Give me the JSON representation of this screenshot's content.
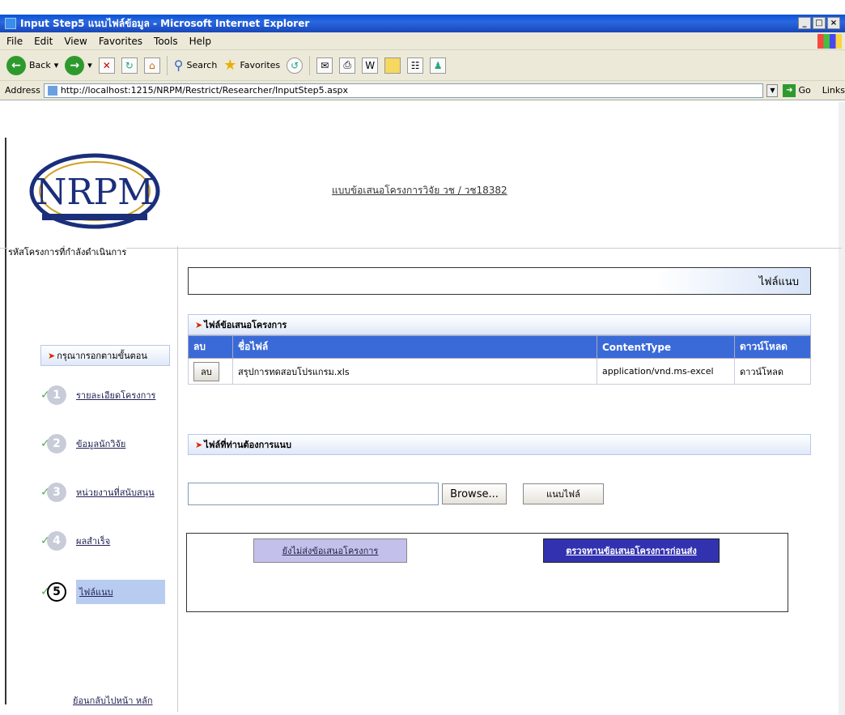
{
  "window": {
    "title": "Input Step5 แนบไฟล์ข้อมูล - Microsoft Internet Explorer",
    "controls": [
      "_",
      "□",
      "×"
    ]
  },
  "menu": [
    "File",
    "Edit",
    "View",
    "Favorites",
    "Tools",
    "Help"
  ],
  "toolbar": {
    "back_label": "Back",
    "search_label": "Search",
    "favorites_label": "Favorites"
  },
  "address": {
    "label": "Address",
    "url": "http://localhost:1215/NRPM/Restrict/Researcher/InputStep5.aspx",
    "go_label": "Go",
    "links_label": "Links"
  },
  "header": {
    "logo_text": "NRPM",
    "page_title": "แบบข้อเสนอโครงการวิจัย วช / วช18382",
    "project_code_label": "รหัสโครงการที่กำลังดำเนินการ"
  },
  "field_title": "ไฟล์แนบ",
  "sidebar": {
    "header": "กรุณากรอกตามขั้นตอน",
    "steps": [
      {
        "num": "1",
        "label": "รายละเอียดโครงการ"
      },
      {
        "num": "2",
        "label": "ข้อมูลนักวิจัย"
      },
      {
        "num": "3",
        "label": "หน่วยงานที่สนับสนุน"
      },
      {
        "num": "4",
        "label": "ผลสำเร็จ"
      },
      {
        "num": "5",
        "label": "ไฟล์แนบ"
      }
    ],
    "back_link": "ย้อนกลับไปหน้า หลัก"
  },
  "files_panel": {
    "title": "ไฟล์ข้อเสนอโครงการ",
    "columns": [
      "ลบ",
      "ชื่อไฟล์",
      "ContentType",
      "ดาวน์โหลด"
    ],
    "rows": [
      {
        "delete": "ลบ",
        "filename": "สรุปการทดสอบโปรแกรม.xls",
        "content_type": "application/vnd.ms-excel",
        "download": "ดาวน์โหลด"
      }
    ]
  },
  "upload_panel": {
    "title": "ไฟล์ที่ท่านต้องการแนบ",
    "input_value": "",
    "browse_label": "Browse...",
    "attach_label": "แนบไฟล์"
  },
  "actions": {
    "save_label": "ยังไม่ส่งข้อเสนอโครงการ",
    "review_label": "ตรวจทานข้อเสนอโครงการก่อนส่ง"
  }
}
